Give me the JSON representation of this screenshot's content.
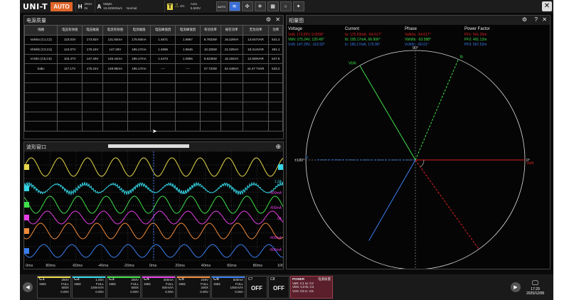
{
  "topbar": {
    "logo": "UNI-T",
    "auto": "AUTO",
    "h_label": "H",
    "h_line1": "20ms",
    "h_line2": "0s",
    "a_label": "A",
    "a_line1": "5Mpts",
    "a_line2": "15.625MSa/s",
    "a_line3": "Normal",
    "t_label": "T",
    "t_line1": "DC",
    "t_line2": "Auto",
    "t_line3": "6.500V",
    "auto_icon": "AUTO",
    "close": "✕"
  },
  "power_panel": {
    "title": "电源质量",
    "headers": [
      "线路",
      "电压有效值",
      "电压幅值",
      "电流有效值",
      "电流幅值",
      "电压峰值因",
      "电流峰值因",
      "有功功率",
      "视在功率",
      "无功功率",
      "功率"
    ],
    "rows": [
      [
        "VaN/Ia (C1,C2)",
        "123.03V",
        "173.82V",
        "131.93mA",
        "175.93mA",
        "1.4671",
        "1.8967",
        "8.7833W",
        "16.229VA",
        "13.647VAR",
        "541.2"
      ],
      [
        "VbN/Ib (C3,C4)",
        "124.07V",
        "175.24V",
        "147.29V",
        "195.17mA",
        "1.4695",
        "1.8546",
        "10.325W",
        "21.025VA",
        "18.314VAR",
        "491.1"
      ],
      [
        "VcN/Ic (C5,C6)",
        "104.47V",
        "147.29V",
        "145.44mA",
        "195.17mA",
        "1.4473",
        "1.0866",
        "8.6235W",
        "15.194VA",
        "12.509VAR",
        "647.5"
      ],
      [
        "Σabc",
        "117.17V",
        "175.24V",
        "148.95mA",
        "195.17mA",
        "----",
        "----",
        "27.733W",
        "52.448VA",
        "44.47 7VAR",
        "533.2"
      ]
    ]
  },
  "wave_panel": {
    "title": "波形窗口",
    "xticks": [
      "0ms",
      "80ms",
      "-60ms",
      "-40ms",
      "-20ms",
      "0ms",
      "20ms",
      "40ms",
      "60ms",
      "80ms",
      "100"
    ],
    "right_labels": [
      "1.2A",
      "800mA",
      "400mA",
      "0A",
      "-400mA",
      "-800mA"
    ]
  },
  "phasor_panel": {
    "title": "相量图",
    "col_headers": [
      "Voltage",
      "Current",
      "Phase",
      "Power Factor"
    ],
    "rows": [
      [
        "VaN: 173.82V, 0.0000°",
        "Ia: 175.93mA, -54.617°",
        "VaN/Ia: -54.617°",
        "PF1: 541.20m"
      ],
      [
        "VbN: 175.24V, 120.49°",
        "Ib: 195.17mA, 66.906°",
        "VbN/Ib: -53.588°",
        "PF2: 491.12m"
      ],
      [
        "VcN: 147.29V, -119.93°",
        "Ic: 195.17mA, 179.96°",
        "VcN/Ic: -60.01°",
        "PF3: 567.52m"
      ]
    ],
    "deg_top": "90°",
    "deg_left": "±180°",
    "deg_right": "0°",
    "deg_bottom": "-90°",
    "vec_van": "VaN",
    "vec_vbn": "VbN",
    "vec_ib": "Ib",
    "vec_ic": "Ic"
  },
  "channels": [
    {
      "name": "C1",
      "l1": "250V",
      "l2": "1MΩ",
      "l3": "FULL",
      "l4": "500X",
      "l5": "0.00V",
      "color": "#e8d84a"
    },
    {
      "name": "C2",
      "l1": "1.00A",
      "l2": "1MΩ",
      "l3": "FULL",
      "l4": "100mV/A",
      "l5": "0.00A",
      "color": "#35d5e5"
    },
    {
      "name": "C3",
      "l1": "250V",
      "l2": "1MΩ",
      "l3": "FULL",
      "l4": "500X",
      "l5": "0.00V",
      "color": "#3fe04a"
    },
    {
      "name": "C4",
      "l1": "400mA",
      "l2": "1MΩ",
      "l3": "FULL",
      "l4": "50mV/A",
      "l5": "0.00A",
      "color": "#e63fe6"
    },
    {
      "name": "C5",
      "l1": "248V",
      "l2": "1MΩ",
      "l3": "FULL",
      "l4": "200X",
      "l5": "0.00V",
      "color": "#f08a3a"
    },
    {
      "name": "C6",
      "l1": "500mA",
      "l2": "1MΩ",
      "l3": "FULL",
      "l4": "100mV/A",
      "l5": "0.00A",
      "color": "#3a7ef0"
    }
  ],
  "off_channels": [
    {
      "name": "C7",
      "state": "OFF"
    },
    {
      "name": "C8",
      "state": "OFF"
    }
  ],
  "power_box": {
    "title": "POWER",
    "sub": "电源质量",
    "r1": "VaN: C1   Ia: C2",
    "r2": "VbN: C3   Ib: C4",
    "r3": "VcN: C5   Ic: C6"
  },
  "clock": {
    "time": "17:29",
    "date": "2025/12/08"
  },
  "colors": {
    "yellow": "#e8d84a",
    "cyan": "#35d5e5",
    "green": "#3fe04a",
    "magenta": "#e63fe6",
    "orange": "#f08a3a",
    "blue": "#3a7ef0",
    "red": "#e02020"
  }
}
